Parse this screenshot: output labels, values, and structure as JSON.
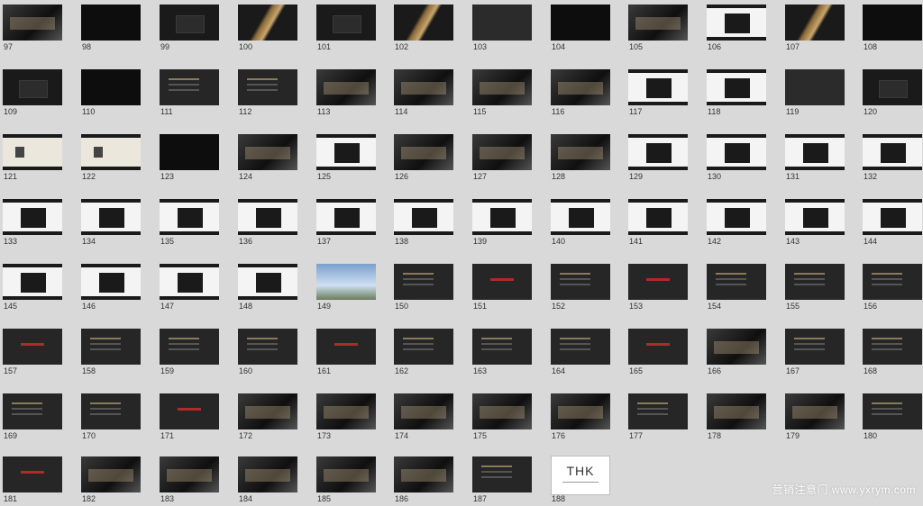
{
  "slides": [
    {
      "num": "97",
      "style": "t-photo"
    },
    {
      "num": "98",
      "style": "t-darker"
    },
    {
      "num": "99",
      "style": "t-dark"
    },
    {
      "num": "100",
      "style": "t-gold"
    },
    {
      "num": "101",
      "style": "t-dark"
    },
    {
      "num": "102",
      "style": "t-gold"
    },
    {
      "num": "103",
      "style": "t-grey"
    },
    {
      "num": "104",
      "style": "t-darker"
    },
    {
      "num": "105",
      "style": "t-photo"
    },
    {
      "num": "106",
      "style": "t-white"
    },
    {
      "num": "107",
      "style": "t-gold"
    },
    {
      "num": "108",
      "style": "t-darker"
    },
    {
      "num": "109",
      "style": "t-dark"
    },
    {
      "num": "110",
      "style": "t-darker"
    },
    {
      "num": "111",
      "style": "t-slide"
    },
    {
      "num": "112",
      "style": "t-slide"
    },
    {
      "num": "113",
      "style": "t-photo"
    },
    {
      "num": "114",
      "style": "t-photo"
    },
    {
      "num": "115",
      "style": "t-photo"
    },
    {
      "num": "116",
      "style": "t-photo"
    },
    {
      "num": "117",
      "style": "t-white"
    },
    {
      "num": "118",
      "style": "t-white"
    },
    {
      "num": "119",
      "style": "t-grey"
    },
    {
      "num": "120",
      "style": "t-dark"
    },
    {
      "num": "121",
      "style": "t-cream"
    },
    {
      "num": "122",
      "style": "t-cream"
    },
    {
      "num": "123",
      "style": "t-darker"
    },
    {
      "num": "124",
      "style": "t-photo"
    },
    {
      "num": "125",
      "style": "t-white"
    },
    {
      "num": "126",
      "style": "t-photo"
    },
    {
      "num": "127",
      "style": "t-photo"
    },
    {
      "num": "128",
      "style": "t-photo"
    },
    {
      "num": "129",
      "style": "t-white"
    },
    {
      "num": "130",
      "style": "t-white"
    },
    {
      "num": "131",
      "style": "t-white"
    },
    {
      "num": "132",
      "style": "t-white"
    },
    {
      "num": "133",
      "style": "t-white"
    },
    {
      "num": "134",
      "style": "t-white"
    },
    {
      "num": "135",
      "style": "t-white"
    },
    {
      "num": "136",
      "style": "t-white"
    },
    {
      "num": "137",
      "style": "t-white"
    },
    {
      "num": "138",
      "style": "t-white"
    },
    {
      "num": "139",
      "style": "t-white"
    },
    {
      "num": "140",
      "style": "t-white"
    },
    {
      "num": "141",
      "style": "t-white"
    },
    {
      "num": "142",
      "style": "t-white"
    },
    {
      "num": "143",
      "style": "t-white"
    },
    {
      "num": "144",
      "style": "t-white"
    },
    {
      "num": "145",
      "style": "t-white"
    },
    {
      "num": "146",
      "style": "t-white"
    },
    {
      "num": "147",
      "style": "t-white"
    },
    {
      "num": "148",
      "style": "t-white"
    },
    {
      "num": "149",
      "style": "t-sky"
    },
    {
      "num": "150",
      "style": "t-slide"
    },
    {
      "num": "151",
      "style": "t-red"
    },
    {
      "num": "152",
      "style": "t-slide"
    },
    {
      "num": "153",
      "style": "t-red"
    },
    {
      "num": "154",
      "style": "t-slide"
    },
    {
      "num": "155",
      "style": "t-slide"
    },
    {
      "num": "156",
      "style": "t-slide"
    },
    {
      "num": "157",
      "style": "t-red"
    },
    {
      "num": "158",
      "style": "t-slide"
    },
    {
      "num": "159",
      "style": "t-slide"
    },
    {
      "num": "160",
      "style": "t-slide"
    },
    {
      "num": "161",
      "style": "t-red"
    },
    {
      "num": "162",
      "style": "t-slide"
    },
    {
      "num": "163",
      "style": "t-slide"
    },
    {
      "num": "164",
      "style": "t-slide"
    },
    {
      "num": "165",
      "style": "t-red"
    },
    {
      "num": "166",
      "style": "t-photo"
    },
    {
      "num": "167",
      "style": "t-slide"
    },
    {
      "num": "168",
      "style": "t-slide"
    },
    {
      "num": "169",
      "style": "t-slide"
    },
    {
      "num": "170",
      "style": "t-slide"
    },
    {
      "num": "171",
      "style": "t-red"
    },
    {
      "num": "172",
      "style": "t-photo"
    },
    {
      "num": "173",
      "style": "t-photo"
    },
    {
      "num": "174",
      "style": "t-photo"
    },
    {
      "num": "175",
      "style": "t-photo"
    },
    {
      "num": "176",
      "style": "t-photo"
    },
    {
      "num": "177",
      "style": "t-slide"
    },
    {
      "num": "178",
      "style": "t-photo"
    },
    {
      "num": "179",
      "style": "t-photo"
    },
    {
      "num": "180",
      "style": "t-slide"
    },
    {
      "num": "181",
      "style": "t-red"
    },
    {
      "num": "182",
      "style": "t-photo"
    },
    {
      "num": "183",
      "style": "t-photo"
    },
    {
      "num": "184",
      "style": "t-photo"
    },
    {
      "num": "185",
      "style": "t-photo"
    },
    {
      "num": "186",
      "style": "t-photo"
    },
    {
      "num": "187",
      "style": "t-slide"
    },
    {
      "num": "188",
      "style": "t-final"
    }
  ],
  "final_slide_text": "THK",
  "watermark": "营销注意门 www.yxrym.com"
}
